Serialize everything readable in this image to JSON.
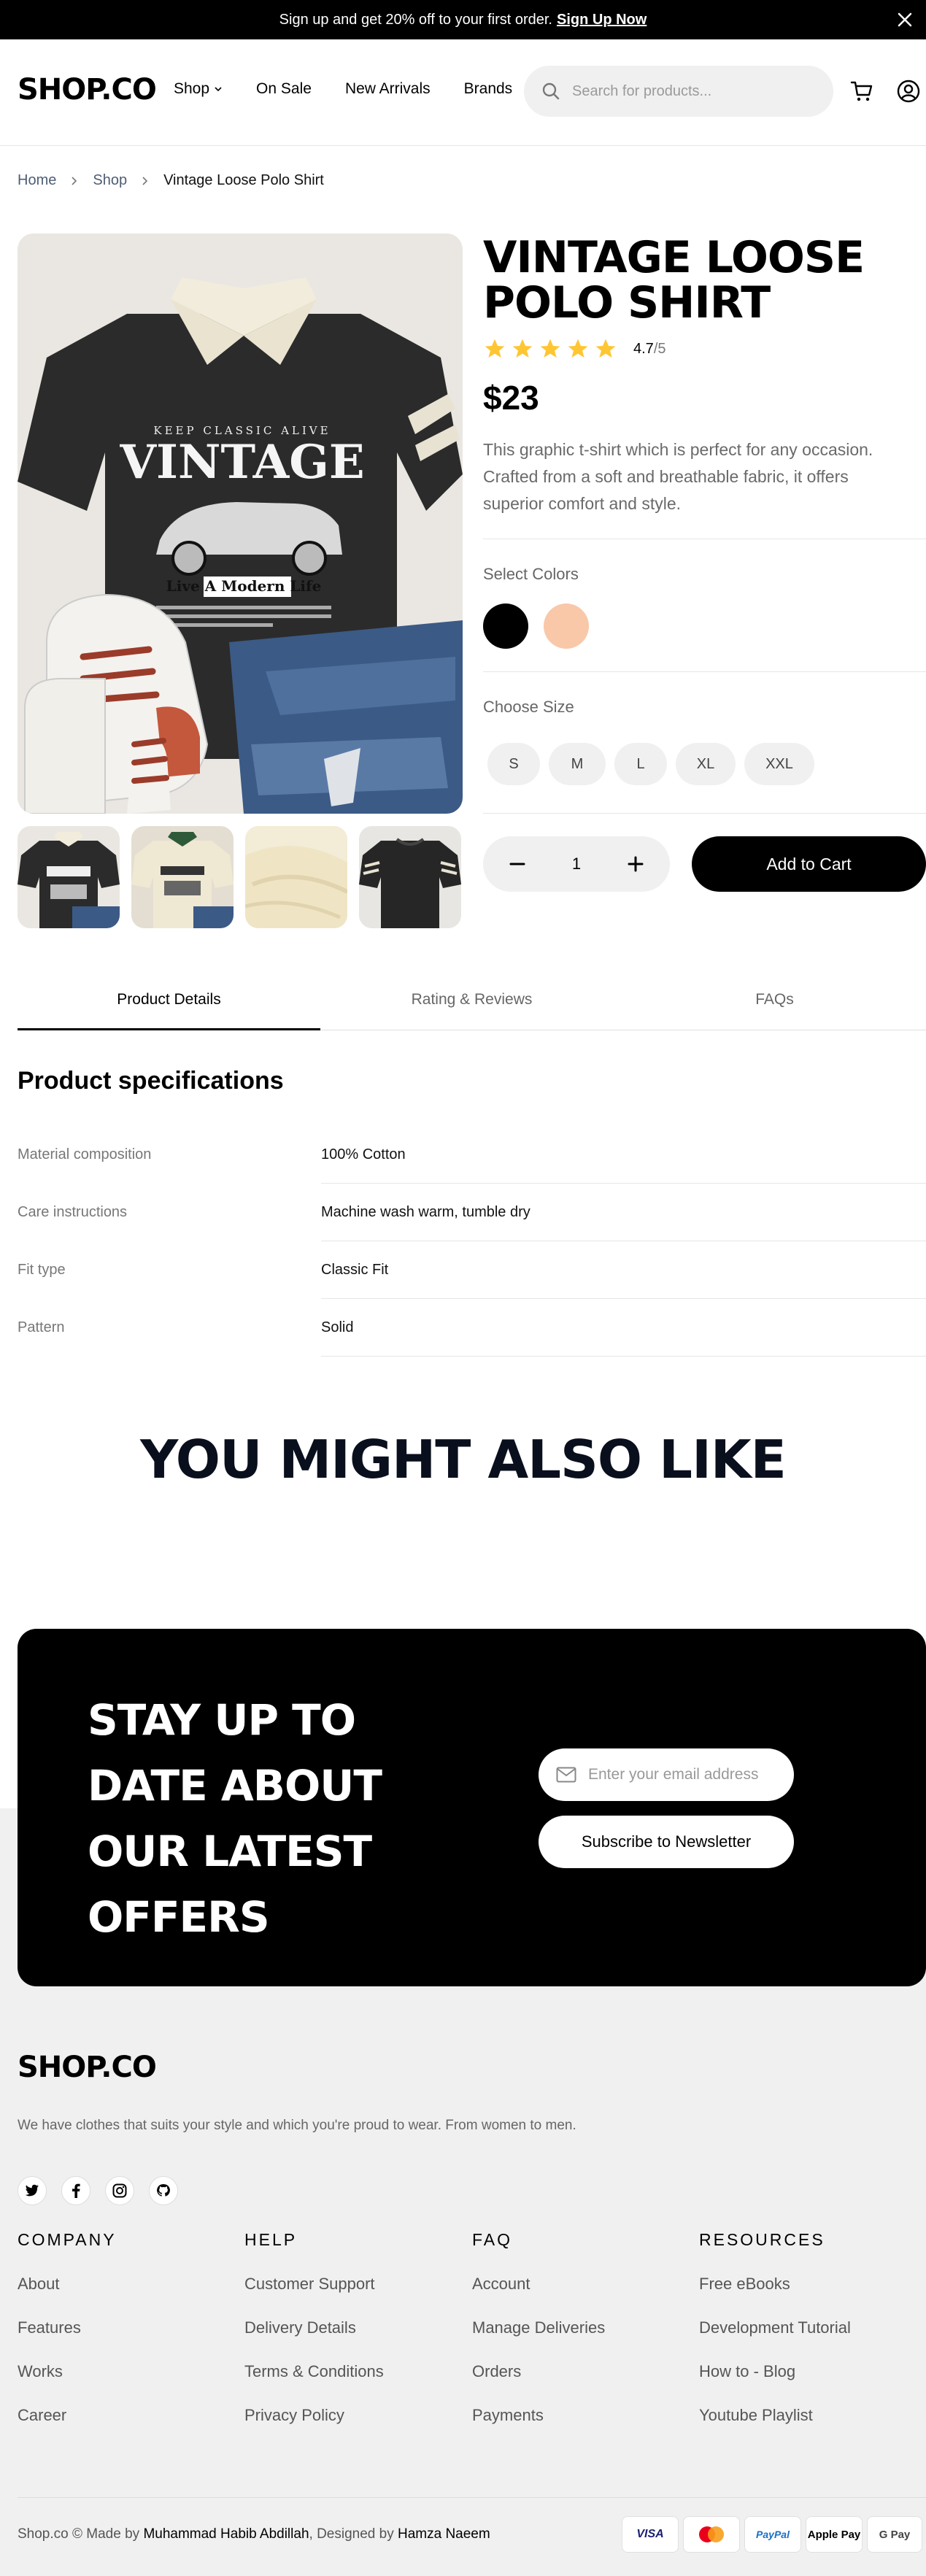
{
  "banner": {
    "text": "Sign up and get 20% off to your first order.",
    "cta": "Sign Up Now"
  },
  "header": {
    "logo": "SHOP.CO",
    "nav": [
      "Shop",
      "On Sale",
      "New Arrivals",
      "Brands"
    ],
    "search_placeholder": "Search for products..."
  },
  "breadcrumb": [
    "Home",
    "Shop",
    "Vintage Loose Polo Shirt"
  ],
  "product": {
    "title_line1": "VINTAGE LOOSE",
    "title_line2": "POLO SHIRT",
    "rating": "4.7",
    "rating_max": "/5",
    "rating_value": 4.7,
    "price": "$23",
    "description": "This graphic t-shirt which is perfect for any occasion. Crafted from a soft and breathable fabric, it offers superior comfort and style.",
    "colors_label": "Select Colors",
    "colors": [
      "#000000",
      "#f9c8a8"
    ],
    "size_label": "Choose Size",
    "sizes": [
      "S",
      "M",
      "L",
      "XL",
      "XXL"
    ],
    "quantity": "1",
    "add_to_cart": "Add to Cart",
    "shirt_text": {
      "line1": "KEEP CLASSIC ALIVE",
      "line2": "VINTAGE",
      "line3": "Live A Modern Life"
    }
  },
  "tabs": [
    "Product Details",
    "Rating & Reviews",
    "FAQs"
  ],
  "specs": {
    "title": "Product specifications",
    "rows": [
      {
        "k": "Material composition",
        "v": "100% Cotton"
      },
      {
        "k": "Care instructions",
        "v": "Machine wash warm, tumble dry"
      },
      {
        "k": "Fit type",
        "v": "Classic Fit"
      },
      {
        "k": "Pattern",
        "v": "Solid"
      }
    ]
  },
  "also_like": "YOU MIGHT ALSO LIKE",
  "newsletter": {
    "title": [
      "STAY UP TO",
      "DATE ABOUT",
      "OUR LATEST",
      "OFFERS"
    ],
    "placeholder": "Enter your email address",
    "button": "Subscribe to Newsletter"
  },
  "footer": {
    "logo": "SHOP.CO",
    "tagline": "We have clothes that suits your style and which you're proud to wear. From women to men.",
    "social_icons": [
      "twitter-icon",
      "facebook-icon",
      "instagram-icon",
      "github-icon"
    ],
    "columns": [
      {
        "title": "COMPANY",
        "links": [
          "About",
          "Features",
          "Works",
          "Career"
        ]
      },
      {
        "title": "HELP",
        "links": [
          "Customer Support",
          "Delivery Details",
          "Terms & Conditions",
          "Privacy Policy"
        ]
      },
      {
        "title": "FAQ",
        "links": [
          "Account",
          "Manage Deliveries",
          "Orders",
          "Payments"
        ]
      },
      {
        "title": "RESOURCES",
        "links": [
          "Free eBooks",
          "Development Tutorial",
          "How to - Blog",
          "Youtube Playlist"
        ]
      }
    ],
    "copyright_prefix": "Shop.co © Made by",
    "author1": "Muhammad Habib Abdillah",
    "copyright_mid": ", Designed by",
    "author2": "Hamza Naeem",
    "payments": [
      "VISA",
      "Mastercard",
      "PayPal",
      "Apple Pay",
      "G Pay"
    ]
  }
}
